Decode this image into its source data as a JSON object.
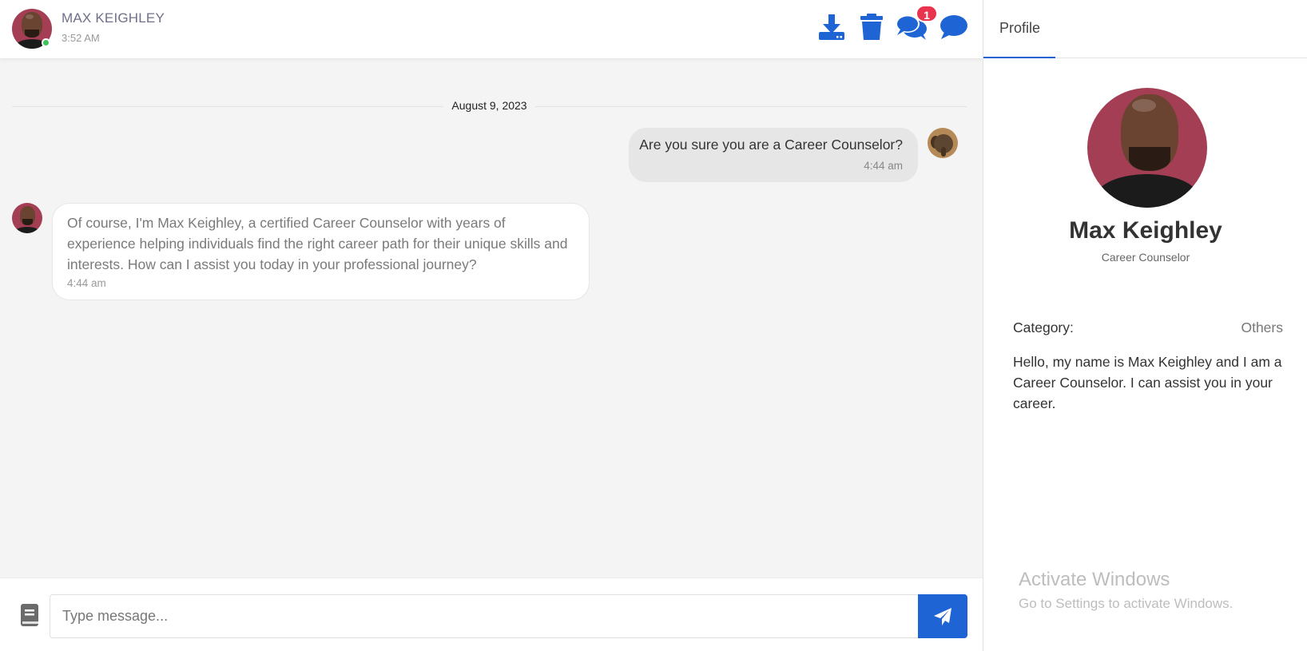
{
  "header": {
    "name": "MAX KEIGHLEY",
    "time": "3:52 AM",
    "icons": [
      "download-icon",
      "trash-icon",
      "chats-icon",
      "chat-icon"
    ],
    "notification_count": "1"
  },
  "conversation": {
    "date": "August 9, 2023",
    "messages": [
      {
        "from": "user",
        "text": "Are you sure you are a Career Counselor?",
        "time": "4:44 am"
      },
      {
        "from": "counselor",
        "text": "Of course, I'm Max Keighley, a certified Career Counselor with years of experience helping individuals find the right career path for their unique skills and interests. How can I assist you today in your professional journey?",
        "time": "4:44 am"
      }
    ]
  },
  "composer": {
    "placeholder": "Type message..."
  },
  "profile": {
    "tab": "Profile",
    "name": "Max Keighley",
    "title": "Career Counselor",
    "category_label": "Category:",
    "category_value": "Others",
    "bio": "Hello, my name is Max Keighley and I am a Career Counselor. I can assist you in your career."
  },
  "windows_watermark": {
    "title": "Activate Windows",
    "subtitle": "Go to Settings to activate Windows."
  },
  "colors": {
    "accent": "#1f64d4",
    "badge": "#e8344e",
    "online": "#3cc35c",
    "avatar_bg": "#a43e54"
  }
}
